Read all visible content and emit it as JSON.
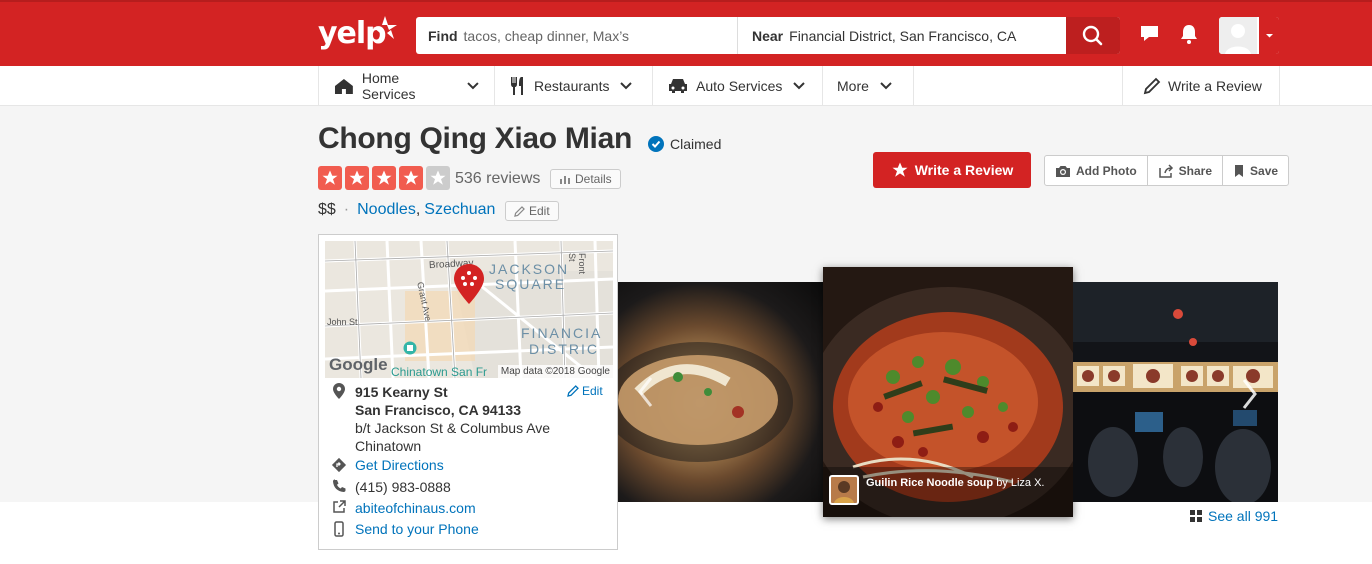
{
  "header": {
    "logo_text": "yelp",
    "search_find_label": "Find",
    "search_find_placeholder": "tacos, cheap dinner, Max’s",
    "search_near_label": "Near",
    "search_near_value": "Financial District, San Francisco, CA"
  },
  "subnav": {
    "items": [
      {
        "label": "Home Services",
        "icon": "house-icon"
      },
      {
        "label": "Restaurants",
        "icon": "fork-knife-icon"
      },
      {
        "label": "Auto Services",
        "icon": "car-icon"
      },
      {
        "label": "More",
        "icon": ""
      }
    ],
    "write_review": "Write a Review"
  },
  "business": {
    "name": "Chong Qing Xiao Mian",
    "claimed": "Claimed",
    "rating": 4,
    "max_rating": 5,
    "reviews": "536 reviews",
    "details": "Details",
    "price": "$$",
    "categories": [
      "Noodles",
      "Szechuan"
    ],
    "category_separator": ",",
    "edit": "Edit"
  },
  "actions": {
    "write_review": "Write a Review",
    "add_photo": "Add Photo",
    "share": "Share",
    "save": "Save"
  },
  "map": {
    "labels": {
      "broadway": "Broadway",
      "jackson": "JACKSON",
      "square": "SQUARE",
      "front_st": "Front St",
      "grant_ave": "Grant Ave",
      "john_st": "John St",
      "financial": "FINANCIA",
      "district": "DISTRIC",
      "chinatown": "Chinatown San Fr",
      "google": "Google",
      "map_data": "Map data ©2018 Google"
    }
  },
  "location": {
    "street": "915 Kearny St",
    "city": "San Francisco, CA 94133",
    "cross": "b/t Jackson St & Columbus Ave",
    "neighborhood": "Chinatown",
    "edit": "Edit",
    "directions": "Get Directions",
    "phone": "(415) 983-0888",
    "website": "abiteofchinaus.com",
    "send_phone": "Send to your Phone"
  },
  "photos": {
    "caption_title": "Guilin Rice Noodle soup",
    "caption_by": "by Liza X.",
    "see_all": "See all 991"
  },
  "colors": {
    "brand_red": "#d32323",
    "link_blue": "#0073bb",
    "star_red": "#f15c4f",
    "star_gray": "#cccccc"
  }
}
